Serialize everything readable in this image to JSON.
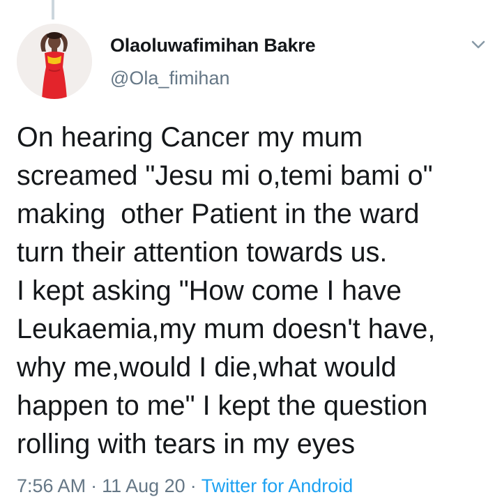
{
  "author": {
    "display_name": "Olaoluwafimihan Bakre",
    "handle": "@Ola_fimihan",
    "avatar_icon": "profile-photo"
  },
  "tweet": {
    "lines": [
      "On hearing Cancer my mum",
      "screamed \"Jesu mi o,temi bami o\"",
      "making  other Patient in the ward",
      "turn their attention towards us.",
      "I kept asking \"How come I have",
      "Leukaemia,my mum doesn't have,",
      "why me,would I die,what would",
      "happen to me\" I kept the question",
      "rolling with tears in my eyes"
    ]
  },
  "meta": {
    "time": "7:56 AM",
    "separator": "·",
    "date": "11 Aug 20",
    "client": "Twitter for Android"
  },
  "icons": {
    "more_menu": "chevron-down-icon"
  },
  "colors": {
    "text_primary": "#14171a",
    "text_secondary": "#657786",
    "link": "#1da1f2",
    "thread_line": "#ccd6dd",
    "avatar_outfit": "#e3242b"
  }
}
